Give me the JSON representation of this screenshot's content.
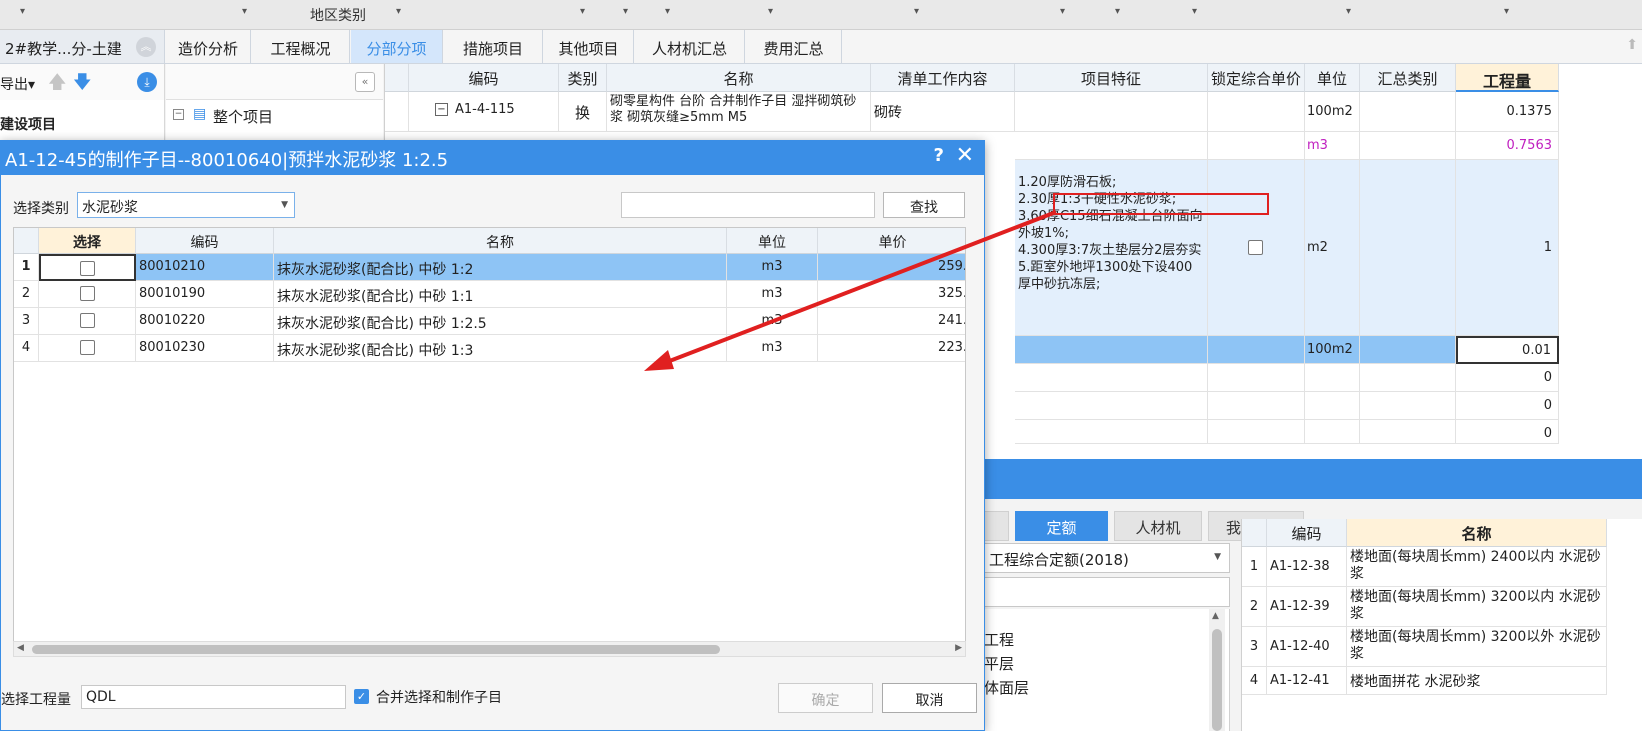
{
  "ribbon": {
    "region_label": "地区类别",
    "arrow": "▾"
  },
  "tabs": {
    "project": "2#教学...分-土建",
    "items": [
      "造价分析",
      "工程概况",
      "分部分项",
      "措施项目",
      "其他项目",
      "人材机汇总",
      "费用汇总"
    ]
  },
  "left": {
    "export": "导出▾",
    "section": "建设项目"
  },
  "tree": {
    "root": "整个项目",
    "collapse": "«"
  },
  "grid": {
    "headers": [
      "编码",
      "类别",
      "名称",
      "清单工作内容",
      "项目特征",
      "锁定综合单价",
      "单位",
      "汇总类别",
      "工程量"
    ],
    "row1": {
      "code": "A1-4-115",
      "type": "换",
      "name": "砌零星构件 台阶  合并制作子目 湿拌砌筑砂浆 砌筑灰缝≥5mm M5",
      "content": "砌砖",
      "unit": "100m2",
      "qty": "0.1375"
    },
    "row2": {
      "unit": "m3",
      "qty": "0.7563"
    },
    "row3": {
      "features": [
        "1.20厚防滑石板;",
        "2.30厚1:3干硬性水泥砂浆;",
        "3.60厚C15细石混凝土台阶面向外坡1%;",
        "4.300厚3:7灰土垫层分2层夯实",
        "5.距室外地坪1300处下设400厚中砂抗冻层;"
      ],
      "unit": "m2",
      "qty": "1"
    },
    "row4": {
      "unit": "100m2",
      "qty": "0.01"
    },
    "zeros": [
      "0",
      "0",
      "0"
    ]
  },
  "lower": {
    "tabs": [
      "定额",
      "人材机",
      "我的数据"
    ],
    "quota_set": "工程综合定额(2018)",
    "tree_items": [
      "工程",
      "平层",
      "体面层"
    ],
    "headers": [
      "编码",
      "名称"
    ],
    "rows": [
      {
        "n": "1",
        "code": "A1-12-38",
        "name": "楼地面(每块周长mm) 2400以内 水泥砂浆"
      },
      {
        "n": "2",
        "code": "A1-12-39",
        "name": "楼地面(每块周长mm) 3200以内 水泥砂浆"
      },
      {
        "n": "3",
        "code": "A1-12-40",
        "name": "楼地面(每块周长mm) 3200以外 水泥砂浆"
      },
      {
        "n": "4",
        "code": "A1-12-41",
        "name": "楼地面拼花 水泥砂浆"
      }
    ]
  },
  "dialog": {
    "title": "A1-12-45的制作子目--80010640|预拌水泥砂浆 1:2.5",
    "help": "?",
    "close": "✕",
    "category_label": "选择类别",
    "category_value": "水泥砂浆",
    "search_button": "查找",
    "headers": [
      "选择",
      "编码",
      "名称",
      "单位",
      "单价"
    ],
    "rows": [
      {
        "n": "1",
        "code": "80010210",
        "name": "抹灰水泥砂浆(配合比) 中砂 1:2",
        "unit": "m3",
        "price": "259."
      },
      {
        "n": "2",
        "code": "80010190",
        "name": "抹灰水泥砂浆(配合比) 中砂 1:1",
        "unit": "m3",
        "price": "325."
      },
      {
        "n": "3",
        "code": "80010220",
        "name": "抹灰水泥砂浆(配合比) 中砂 1:2.5",
        "unit": "m3",
        "price": "241."
      },
      {
        "n": "4",
        "code": "80010230",
        "name": "抹灰水泥砂浆(配合比) 中砂 1:3",
        "unit": "m3",
        "price": "223."
      }
    ],
    "bottom_label": "选择工程量",
    "bottom_value": "QDL",
    "merge_label": "合并选择和制作子目",
    "ok": "确定",
    "cancel": "取消"
  },
  "colors": {
    "accent": "#3a8ee6",
    "selection": "#8ec4f5",
    "highlight_box": "#e02020",
    "qty_magenta": "#c020c0"
  }
}
